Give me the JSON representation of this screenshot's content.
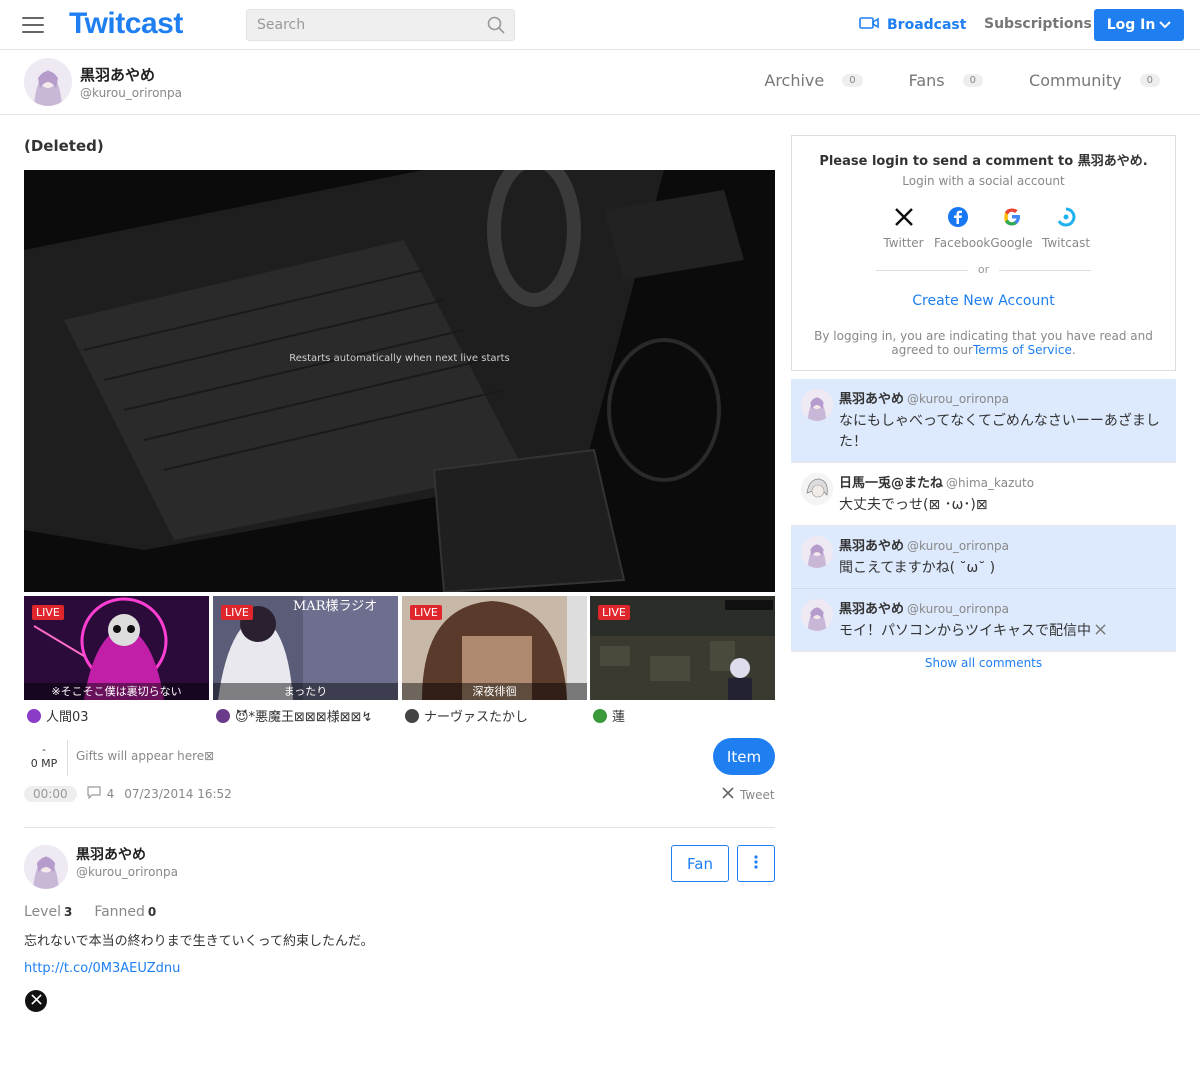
{
  "header": {
    "logo": "Twitcast",
    "search_placeholder": "Search",
    "broadcast": "Broadcast",
    "subscriptions": "Subscriptions",
    "login": "Log In",
    "accent": "#1f7ff0"
  },
  "user": {
    "name": "黒羽あやめ",
    "handle": "@kurou_orironpa",
    "tabs": [
      {
        "label": "Archive",
        "count": "0"
      },
      {
        "label": "Fans",
        "count": "0"
      },
      {
        "label": "Community",
        "count": "0"
      }
    ]
  },
  "movie": {
    "title": "(Deleted)",
    "player_message": "Restarts automatically when next live starts"
  },
  "recommended": [
    {
      "badge": "LIVE",
      "caption": "※そこそこ僕は裏切らない",
      "user": "人間03",
      "bg": "#3a0f4a"
    },
    {
      "badge": "LIVE",
      "caption": "まったり",
      "user": "😈*悪魔王⊠⊠⊠様⊠⊠↯",
      "bg": "#4d4f66"
    },
    {
      "badge": "LIVE",
      "caption": "深夜徘徊",
      "user": "ナーヴァスたかし",
      "bg": "#7a5a44"
    },
    {
      "badge": "LIVE",
      "caption": "",
      "user": "蓮",
      "bg": "#2f332c"
    }
  ],
  "gift": {
    "mp_dash": "-",
    "mp_label": "0 MP",
    "placeholder": "Gifts will appear here⊠",
    "item_button": "Item"
  },
  "meta": {
    "duration": "00:00",
    "comment_count": "4",
    "date": "07/23/2014 16:52",
    "tweet": "Tweet"
  },
  "profile": {
    "name": "黒羽あやめ",
    "handle": "@kurou_orironpa",
    "fan_button": "Fan",
    "level_label": "Level",
    "level": "3",
    "fanned_label": "Fanned",
    "fanned": "0",
    "bio": "忘れないで本当の終わりまで生きていくって約束したんだ。",
    "link": "http://t.co/0M3AEUZdnu"
  },
  "login_box": {
    "title": "Please login to send a comment to 黒羽あやめ.",
    "subtitle": "Login with a social account",
    "socials": [
      "Twitter",
      "Facebook",
      "Google",
      "Twitcast"
    ],
    "or": "or",
    "create": "Create New Account",
    "terms_prefix": "By logging in, you are indicating that you have read and agreed to our",
    "terms_link": "Terms of Service",
    "terms_suffix": "."
  },
  "comments": [
    {
      "name": "黒羽あやめ",
      "handle": "@kurou_orironpa",
      "text": "なにもしゃべってなくてごめんなさいーーあざました！",
      "mine": true
    },
    {
      "name": "日馬一兎@またね",
      "handle": "@hima_kazuto",
      "text": "大丈夫でっせ(⊠ ･ω･)⊠",
      "mine": false
    },
    {
      "name": "黒羽あやめ",
      "handle": "@kurou_orironpa",
      "text": "聞こえてますかね( ˘ω˘ )",
      "mine": true
    },
    {
      "name": "黒羽あやめ",
      "handle": "@kurou_orironpa",
      "text": "モイ！パソコンからツイキャスで配信中",
      "mine": true
    }
  ],
  "show_all": "Show all comments"
}
